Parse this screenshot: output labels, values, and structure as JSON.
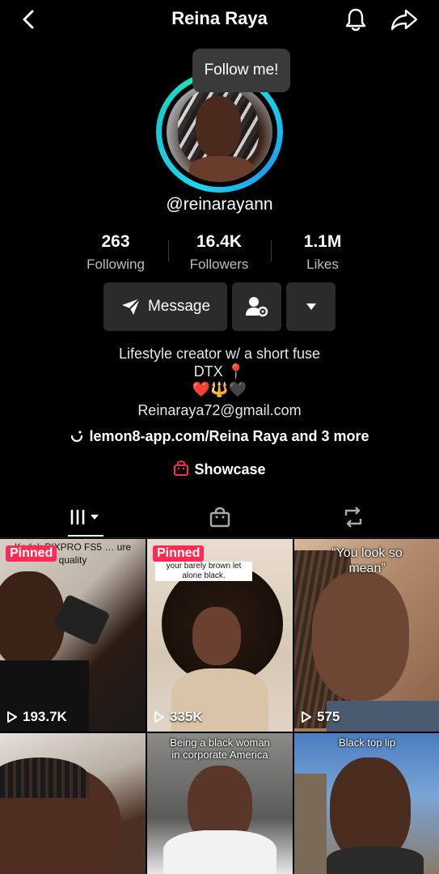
{
  "header": {
    "title": "Reina Raya"
  },
  "profile": {
    "tooltip": "Follow me!",
    "username": "@reinarayann"
  },
  "stats": [
    {
      "value": "263",
      "label": "Following"
    },
    {
      "value": "16.4K",
      "label": "Followers"
    },
    {
      "value": "1.1M",
      "label": "Likes"
    }
  ],
  "actions": {
    "message_label": "Message"
  },
  "bio": {
    "line1": "Lifestyle creator w/ a short fuse",
    "line2": "DTX 📍",
    "line3": "❤️🔱🖤",
    "email": "Reinaraya72@gmail.com",
    "link": "lemon8-app.com/Reina Raya and 3 more",
    "showcase": "Showcase"
  },
  "videos": [
    {
      "pinned": "Pinned",
      "views": "193.7K",
      "caption": "Kodak PIXPRO FS5 … ure quality",
      "bg": "#c9c2b8"
    },
    {
      "pinned": "Pinned",
      "views": "335K",
      "caption": "your barely brown let alone black.",
      "bg": "#d9cbb6"
    },
    {
      "views": "575",
      "caption": "“You look so mean”",
      "bg": "#7a5a48"
    },
    {
      "views": "",
      "caption": "",
      "bg": "#6a4a3c"
    },
    {
      "views": "",
      "caption": "Being a black woman in corporate America",
      "bg": "#4a4a48"
    },
    {
      "views": "",
      "caption": "Black top lip",
      "bg": "#4e7bb8"
    }
  ],
  "colors": {
    "pinned": "#fe2c55",
    "ring": "#21d4ea",
    "button": "#2b2b2b"
  }
}
